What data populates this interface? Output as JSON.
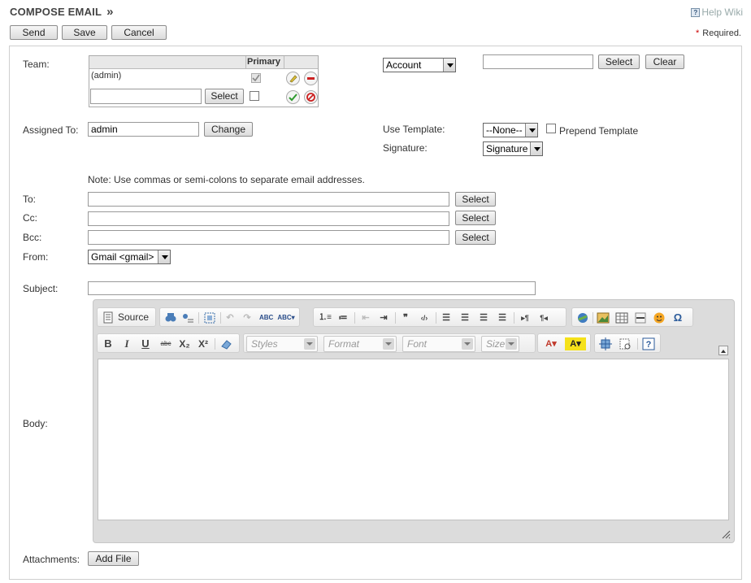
{
  "header": {
    "title": "COMPOSE EMAIL",
    "chevron": "»",
    "help_label": "Help Wiki",
    "help_icon": "help-question-icon"
  },
  "actions": {
    "send": "Send",
    "save": "Save",
    "cancel": "Cancel"
  },
  "required": {
    "star": "*",
    "label": "Required."
  },
  "team": {
    "label": "Team:",
    "primary_header": "Primary",
    "row_value": "(admin)",
    "row_primary_checked": true,
    "new_input_value": "",
    "select_label": "Select"
  },
  "parent": {
    "type_value": "Account",
    "name_value": "",
    "select_label": "Select",
    "clear_label": "Clear"
  },
  "assigned": {
    "label": "Assigned To:",
    "value": "admin",
    "change_label": "Change"
  },
  "template": {
    "label": "Use Template:",
    "value": "--None--",
    "prepend_label": "Prepend Template",
    "prepend_checked": false
  },
  "signature": {
    "label": "Signature:",
    "value": "Signature"
  },
  "recipients": {
    "note": "Note: Use commas or semi-colons to separate email addresses.",
    "to_label": "To:",
    "cc_label": "Cc:",
    "bcc_label": "Bcc:",
    "to_value": "",
    "cc_value": "",
    "bcc_value": "",
    "select_label": "Select"
  },
  "from": {
    "label": "From:",
    "value": "Gmail <gmail>"
  },
  "subject": {
    "label": "Subject:",
    "value": ""
  },
  "body": {
    "label": "Body:",
    "toolbar": {
      "source_label": "Source",
      "styles_placeholder": "Styles",
      "format_placeholder": "Format",
      "font_placeholder": "Font",
      "size_placeholder": "Size",
      "abc_label": "ABC",
      "strike_label": "abc"
    }
  },
  "attachments": {
    "label": "Attachments:",
    "add_file_label": "Add File"
  }
}
